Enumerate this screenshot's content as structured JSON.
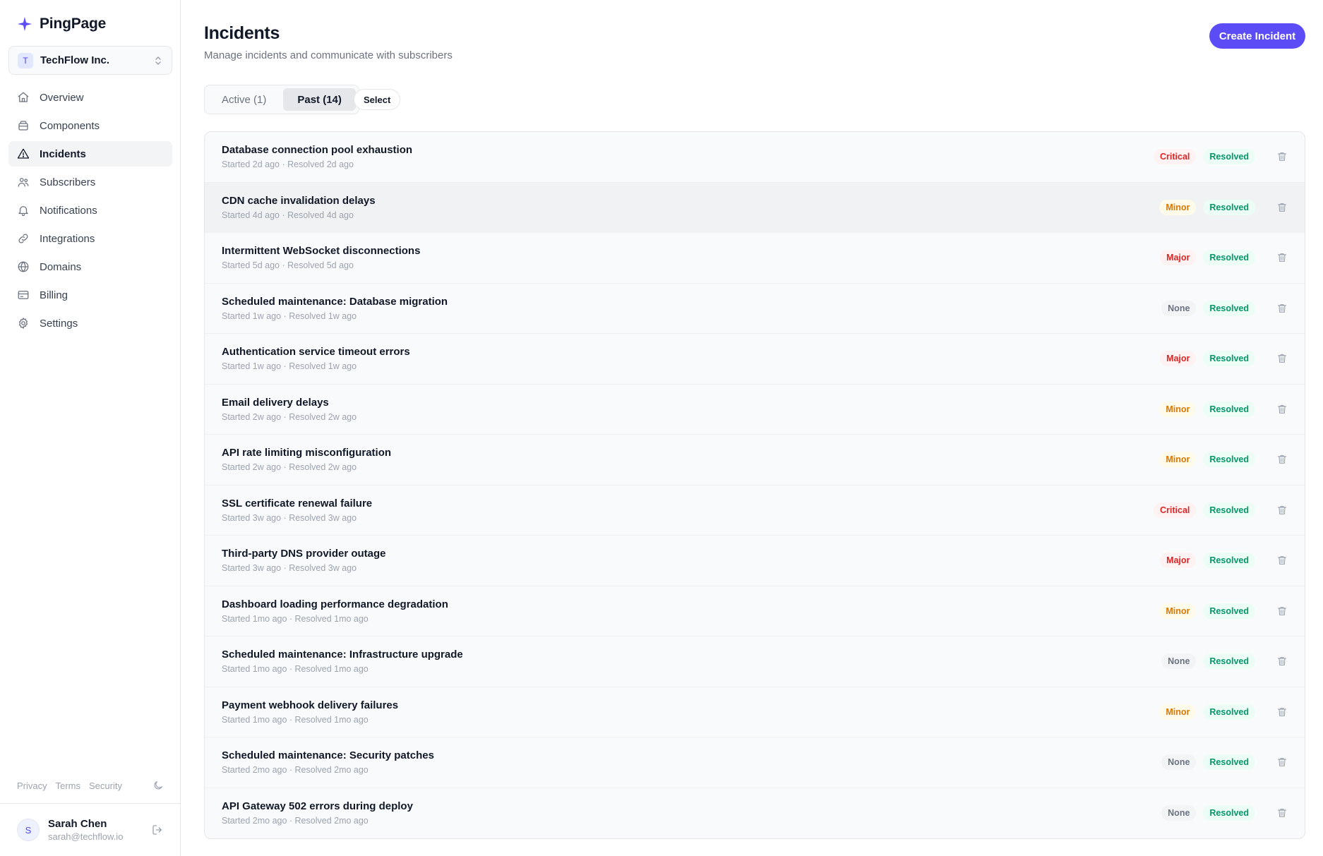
{
  "brand": {
    "name": "PingPage",
    "accent": "#5b4cf5"
  },
  "org": {
    "initial": "T",
    "name": "TechFlow Inc."
  },
  "nav": [
    {
      "key": "overview",
      "label": "Overview",
      "icon": "home-icon",
      "active": false
    },
    {
      "key": "components",
      "label": "Components",
      "icon": "layers-icon",
      "active": false
    },
    {
      "key": "incidents",
      "label": "Incidents",
      "icon": "alert-triangle-icon",
      "active": true
    },
    {
      "key": "subscribers",
      "label": "Subscribers",
      "icon": "users-icon",
      "active": false
    },
    {
      "key": "notifications",
      "label": "Notifications",
      "icon": "bell-icon",
      "active": false
    },
    {
      "key": "integrations",
      "label": "Integrations",
      "icon": "link-icon",
      "active": false
    },
    {
      "key": "domains",
      "label": "Domains",
      "icon": "globe-icon",
      "active": false
    },
    {
      "key": "billing",
      "label": "Billing",
      "icon": "credit-card-icon",
      "active": false
    },
    {
      "key": "settings",
      "label": "Settings",
      "icon": "gear-icon",
      "active": false
    }
  ],
  "footer": {
    "privacy": "Privacy",
    "terms": "Terms",
    "security": "Security"
  },
  "user": {
    "initial": "S",
    "name": "Sarah Chen",
    "email": "sarah@techflow.io"
  },
  "header": {
    "title": "Incidents",
    "subtitle": "Manage incidents and communicate with subscribers",
    "create_label": "Create Incident"
  },
  "tabs": [
    {
      "label": "Active (1)",
      "active": false
    },
    {
      "label": "Past (14)",
      "active": true
    }
  ],
  "select_label": "Select",
  "incidents": [
    {
      "title": "Database connection pool exhaustion",
      "meta": "Started 2d ago · Resolved 2d ago",
      "severity": "Critical",
      "status": "Resolved"
    },
    {
      "title": "CDN cache invalidation delays",
      "meta": "Started 4d ago · Resolved 4d ago",
      "severity": "Minor",
      "status": "Resolved"
    },
    {
      "title": "Intermittent WebSocket disconnections",
      "meta": "Started 5d ago · Resolved 5d ago",
      "severity": "Major",
      "status": "Resolved"
    },
    {
      "title": "Scheduled maintenance: Database migration",
      "meta": "Started 1w ago · Resolved 1w ago",
      "severity": "None",
      "status": "Resolved"
    },
    {
      "title": "Authentication service timeout errors",
      "meta": "Started 1w ago · Resolved 1w ago",
      "severity": "Major",
      "status": "Resolved"
    },
    {
      "title": "Email delivery delays",
      "meta": "Started 2w ago · Resolved 2w ago",
      "severity": "Minor",
      "status": "Resolved"
    },
    {
      "title": "API rate limiting misconfiguration",
      "meta": "Started 2w ago · Resolved 2w ago",
      "severity": "Minor",
      "status": "Resolved"
    },
    {
      "title": "SSL certificate renewal failure",
      "meta": "Started 3w ago · Resolved 3w ago",
      "severity": "Critical",
      "status": "Resolved"
    },
    {
      "title": "Third-party DNS provider outage",
      "meta": "Started 3w ago · Resolved 3w ago",
      "severity": "Major",
      "status": "Resolved"
    },
    {
      "title": "Dashboard loading performance degradation",
      "meta": "Started 1mo ago · Resolved 1mo ago",
      "severity": "Minor",
      "status": "Resolved"
    },
    {
      "title": "Scheduled maintenance: Infrastructure upgrade",
      "meta": "Started 1mo ago · Resolved 1mo ago",
      "severity": "None",
      "status": "Resolved"
    },
    {
      "title": "Payment webhook delivery failures",
      "meta": "Started 1mo ago · Resolved 1mo ago",
      "severity": "Minor",
      "status": "Resolved"
    },
    {
      "title": "Scheduled maintenance: Security patches",
      "meta": "Started 2mo ago · Resolved 2mo ago",
      "severity": "None",
      "status": "Resolved"
    },
    {
      "title": "API Gateway 502 errors during deploy",
      "meta": "Started 2mo ago · Resolved 2mo ago",
      "severity": "None",
      "status": "Resolved"
    }
  ]
}
